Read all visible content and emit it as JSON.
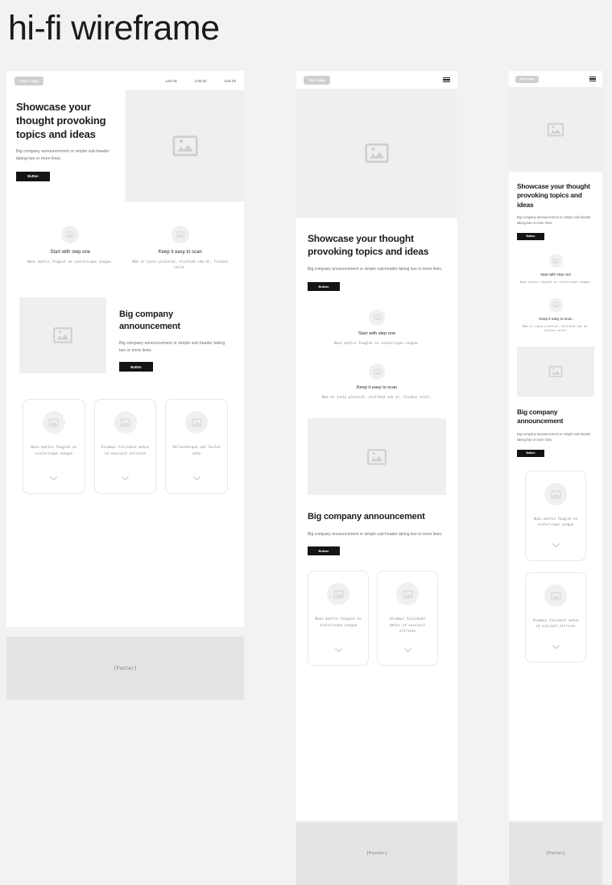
{
  "page": {
    "title": "hi-fi wireframe"
  },
  "brand": {
    "logo_label": "Your Logo",
    "accent_dark": "#141414",
    "placeholder_gray": "#cfcfcf",
    "panel_gray": "#efefef",
    "page_bg": "#f2f2f2"
  },
  "nav": {
    "links": [
      {
        "label": "Link 01"
      },
      {
        "label": "Link 02"
      },
      {
        "label": "Link 03"
      }
    ],
    "menu_icon": "hamburger-icon"
  },
  "hero": {
    "headline": "Showcase your thought provoking topics and ideas",
    "subcopy": "Big company announcement or simple sub-header taking two or more lines.",
    "button_label": "Button",
    "image_icon": "image-placeholder-icon"
  },
  "features": [
    {
      "title": "Start with step one",
      "body": "Nunc mattis feugiat ex scelerisque congue.",
      "icon": "image-placeholder-icon"
    },
    {
      "title": "Keep it easy to scan",
      "body": "Nam ut justo placerat, eleifend sem at, finibus velit.",
      "icon": "image-placeholder-icon"
    }
  ],
  "announcement": {
    "headline": "Big company announcement",
    "subcopy": "Big company announcement or simple sub-header taking two or more lines.",
    "button_label": "Button",
    "image_icon": "image-placeholder-icon"
  },
  "cards": [
    {
      "text": "Nunc mattis feugiat ex scelerisque congue",
      "icon": "image-placeholder-icon",
      "expand_icon": "chevron-down-icon"
    },
    {
      "text": "Vivamus tincidunt metus id suscipit ultrices",
      "icon": "image-placeholder-icon",
      "expand_icon": "chevron-down-icon"
    },
    {
      "text": "Pellentesque non lectus ante",
      "icon": "image-placeholder-icon",
      "expand_icon": "chevron-down-icon"
    }
  ],
  "footer": {
    "label": "[Footer]"
  }
}
